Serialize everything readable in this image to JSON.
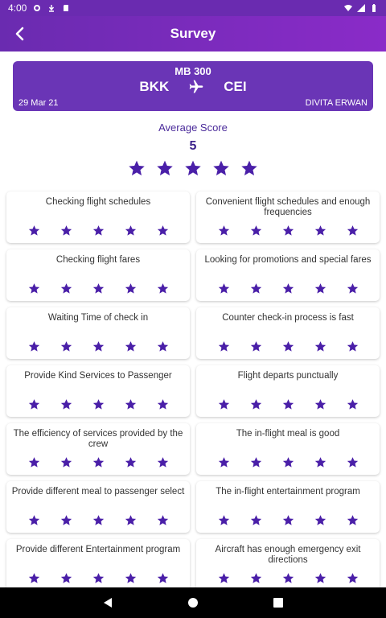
{
  "status_bar": {
    "time": "4:00"
  },
  "header": {
    "title": "Survey"
  },
  "flight": {
    "number": "MB 300",
    "origin": "BKK",
    "destination": "CEI",
    "date": "29 Mar 21",
    "passenger": "DIVITA ERWAN"
  },
  "average": {
    "label": "Average Score",
    "value": "5",
    "rating": 5,
    "max": 5
  },
  "colors": {
    "accent": "#4a1fa8",
    "header_start": "#6a2bb0",
    "header_end": "#8a2bc8",
    "card": "#6a35b6"
  },
  "questions": [
    {
      "text": "Checking flight schedules",
      "rating": 5
    },
    {
      "text": "Convenient flight schedules and enough frequencies",
      "rating": 5
    },
    {
      "text": "Checking flight fares",
      "rating": 5
    },
    {
      "text": "Looking for promotions and special fares",
      "rating": 5
    },
    {
      "text": "Waiting Time of check in",
      "rating": 5
    },
    {
      "text": "Counter check-in process is fast",
      "rating": 5
    },
    {
      "text": "Provide Kind Services to Passenger",
      "rating": 5
    },
    {
      "text": "Flight departs punctually",
      "rating": 5
    },
    {
      "text": "The efficiency of services provided by the crew",
      "rating": 5
    },
    {
      "text": "The in-flight meal is good",
      "rating": 5
    },
    {
      "text": "Provide different meal to passenger select",
      "rating": 5
    },
    {
      "text": "The in-flight entertainment program",
      "rating": 5
    },
    {
      "text": "Provide different Entertainment program",
      "rating": 5
    },
    {
      "text": "Aircraft has enough emergency exit directions",
      "rating": 5
    }
  ]
}
